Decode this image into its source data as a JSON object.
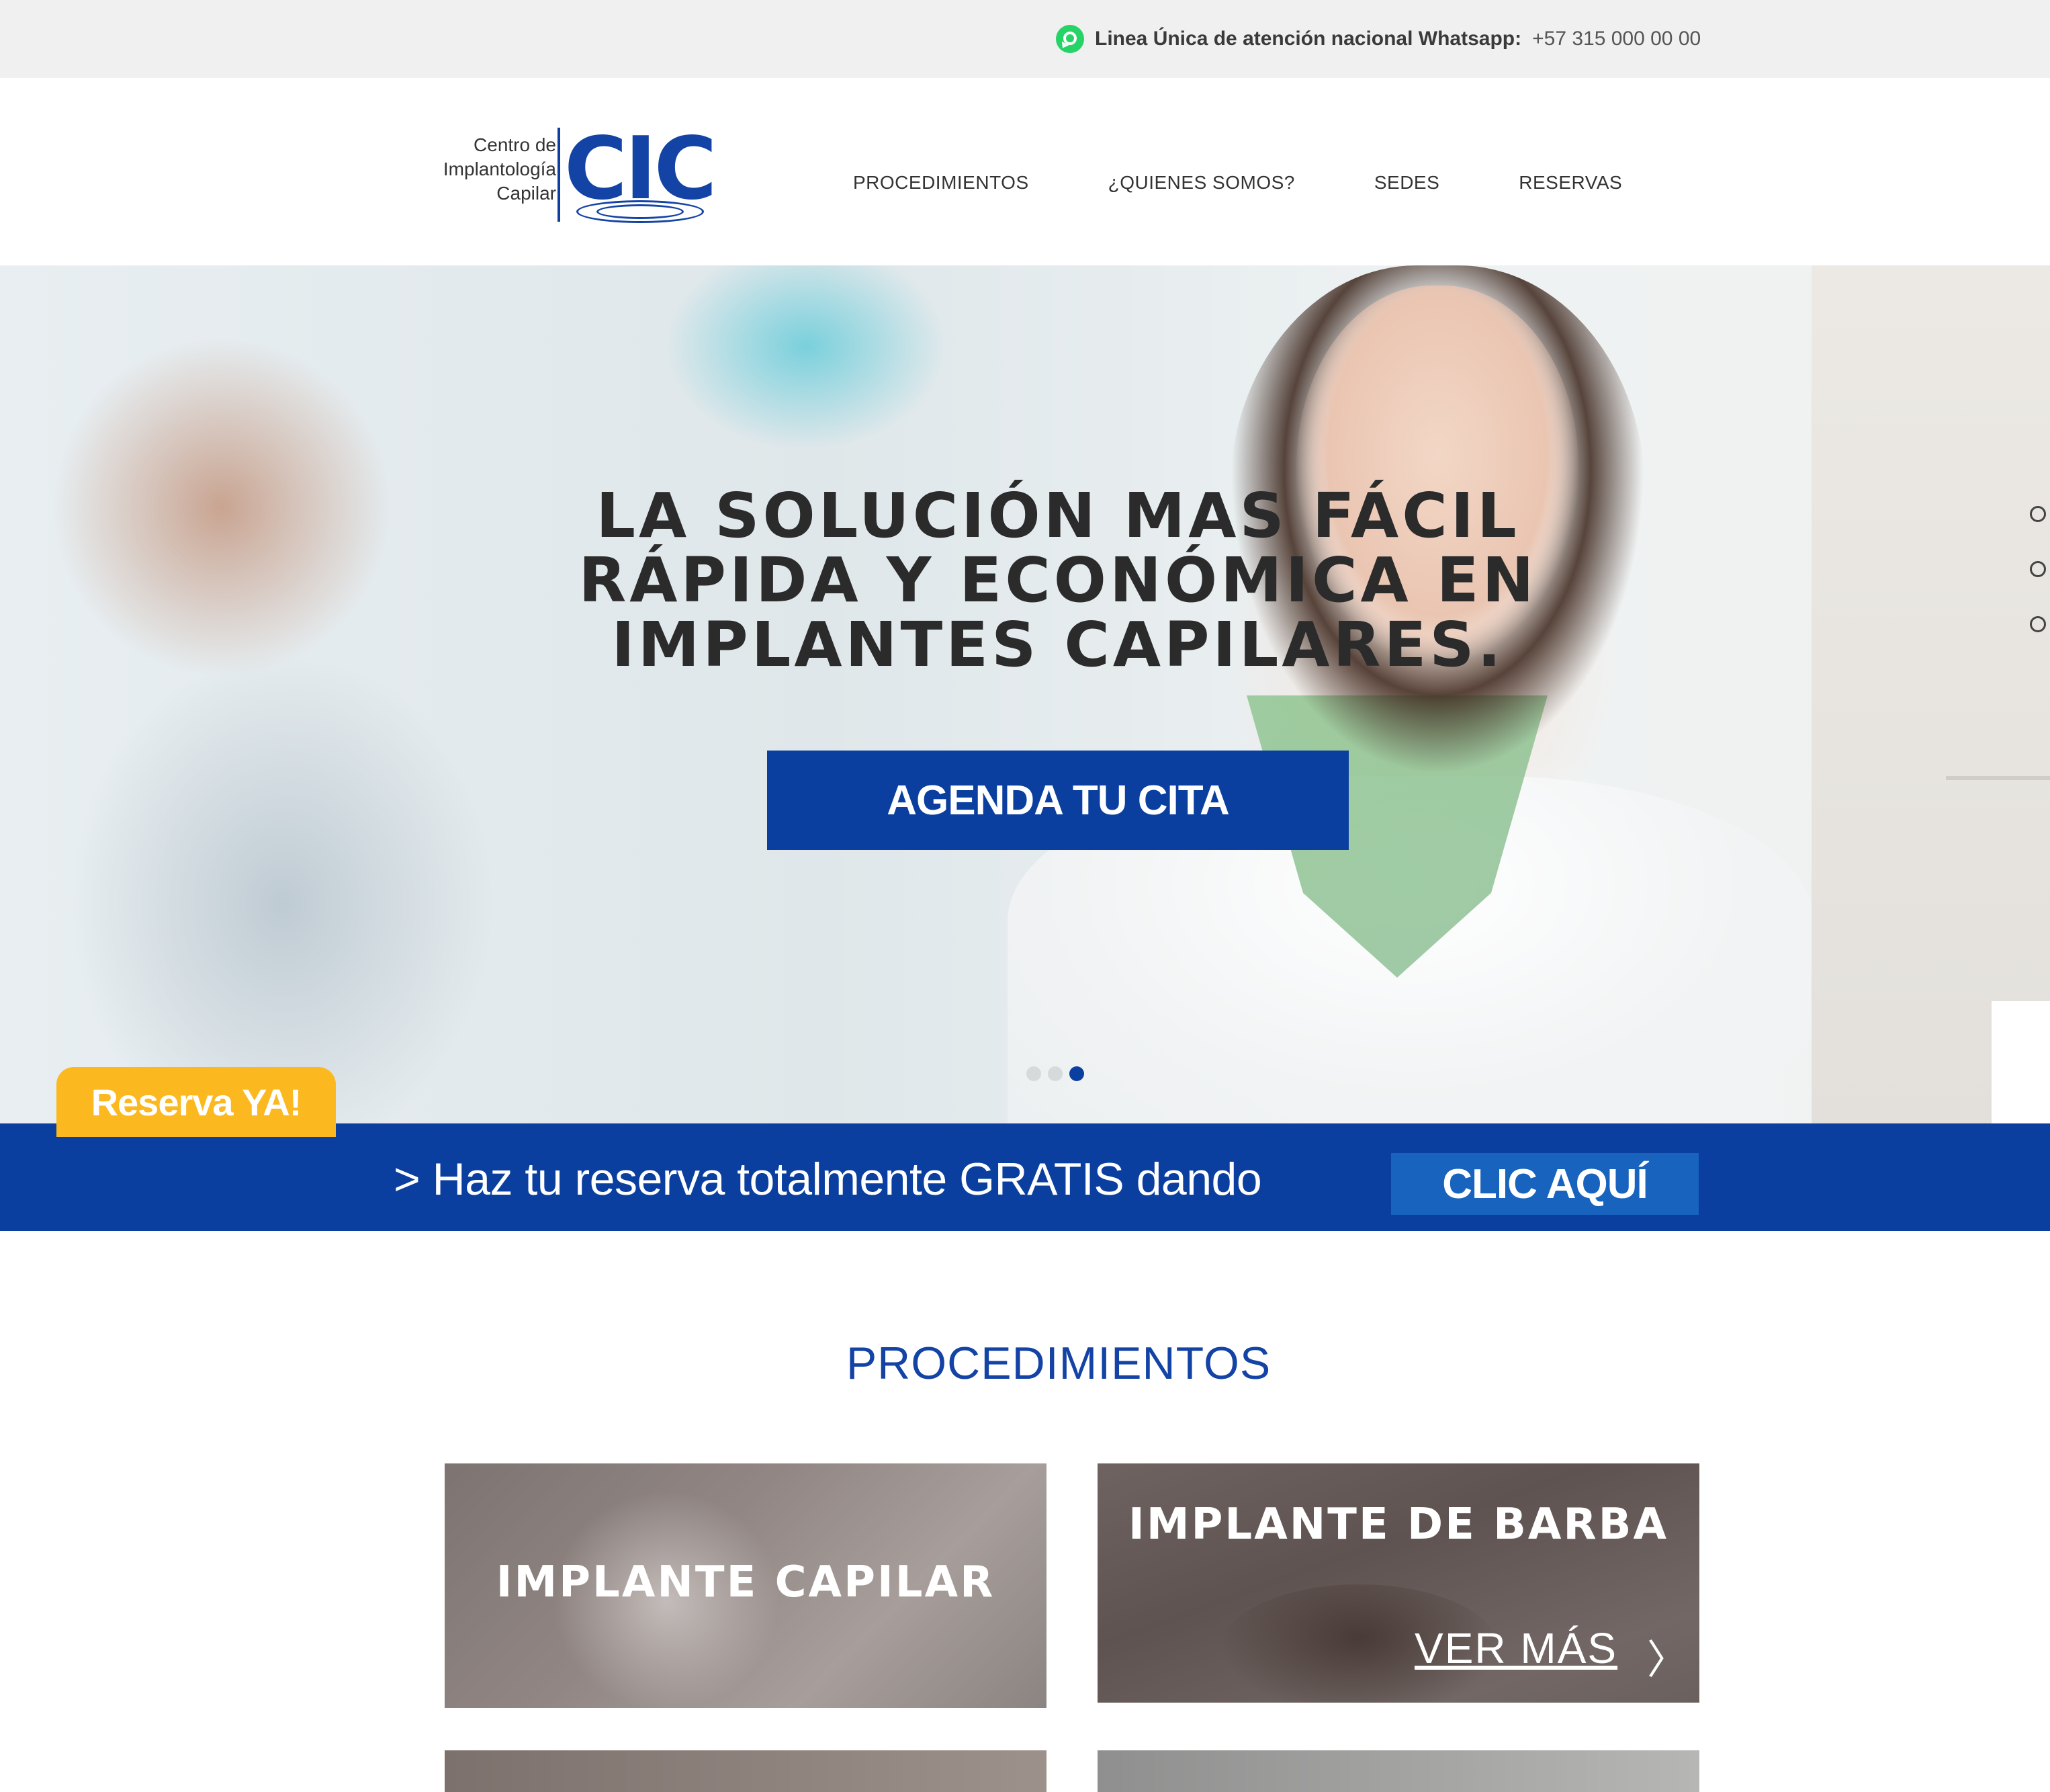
{
  "topbar": {
    "whatsapp_label": "Linea Única de atención nacional Whatsapp:",
    "whatsapp_phone": "+57 315 000 00 00",
    "icon": "whatsapp-icon"
  },
  "header": {
    "logo_text": "Centro de\nImplantología\nCapilar",
    "logo_mark": "CIC",
    "nav": [
      "PROCEDIMIENTOS",
      "¿QUIENES SOMOS?",
      "SEDES",
      "RESERVAS"
    ]
  },
  "hero": {
    "headline": "LA SOLUCIÓN MAS FÁCIL\nRÁPIDA Y ECONÓMICA EN\nIMPLANTES CAPILARES.",
    "cta_label": "AGENDA TU CITA",
    "slides_count": 3,
    "active_slide": 3,
    "reserva_tag": "Reserva YA!"
  },
  "band": {
    "text": "> Haz tu reserva totalmente GRATIS dando",
    "button_label": "CLIC AQUÍ"
  },
  "procedimientos": {
    "title": "PROCEDIMIENTOS",
    "cards": [
      {
        "title": "IMPLANTE CAPILAR"
      },
      {
        "title": "IMPLANTE DE BARBA",
        "link": "VER MÁS"
      }
    ]
  },
  "colors": {
    "brand_blue": "#0a3fa0",
    "button_blue_light": "#1863be",
    "accent_yellow": "#fbb81f",
    "whatsapp_green": "#25d366"
  }
}
